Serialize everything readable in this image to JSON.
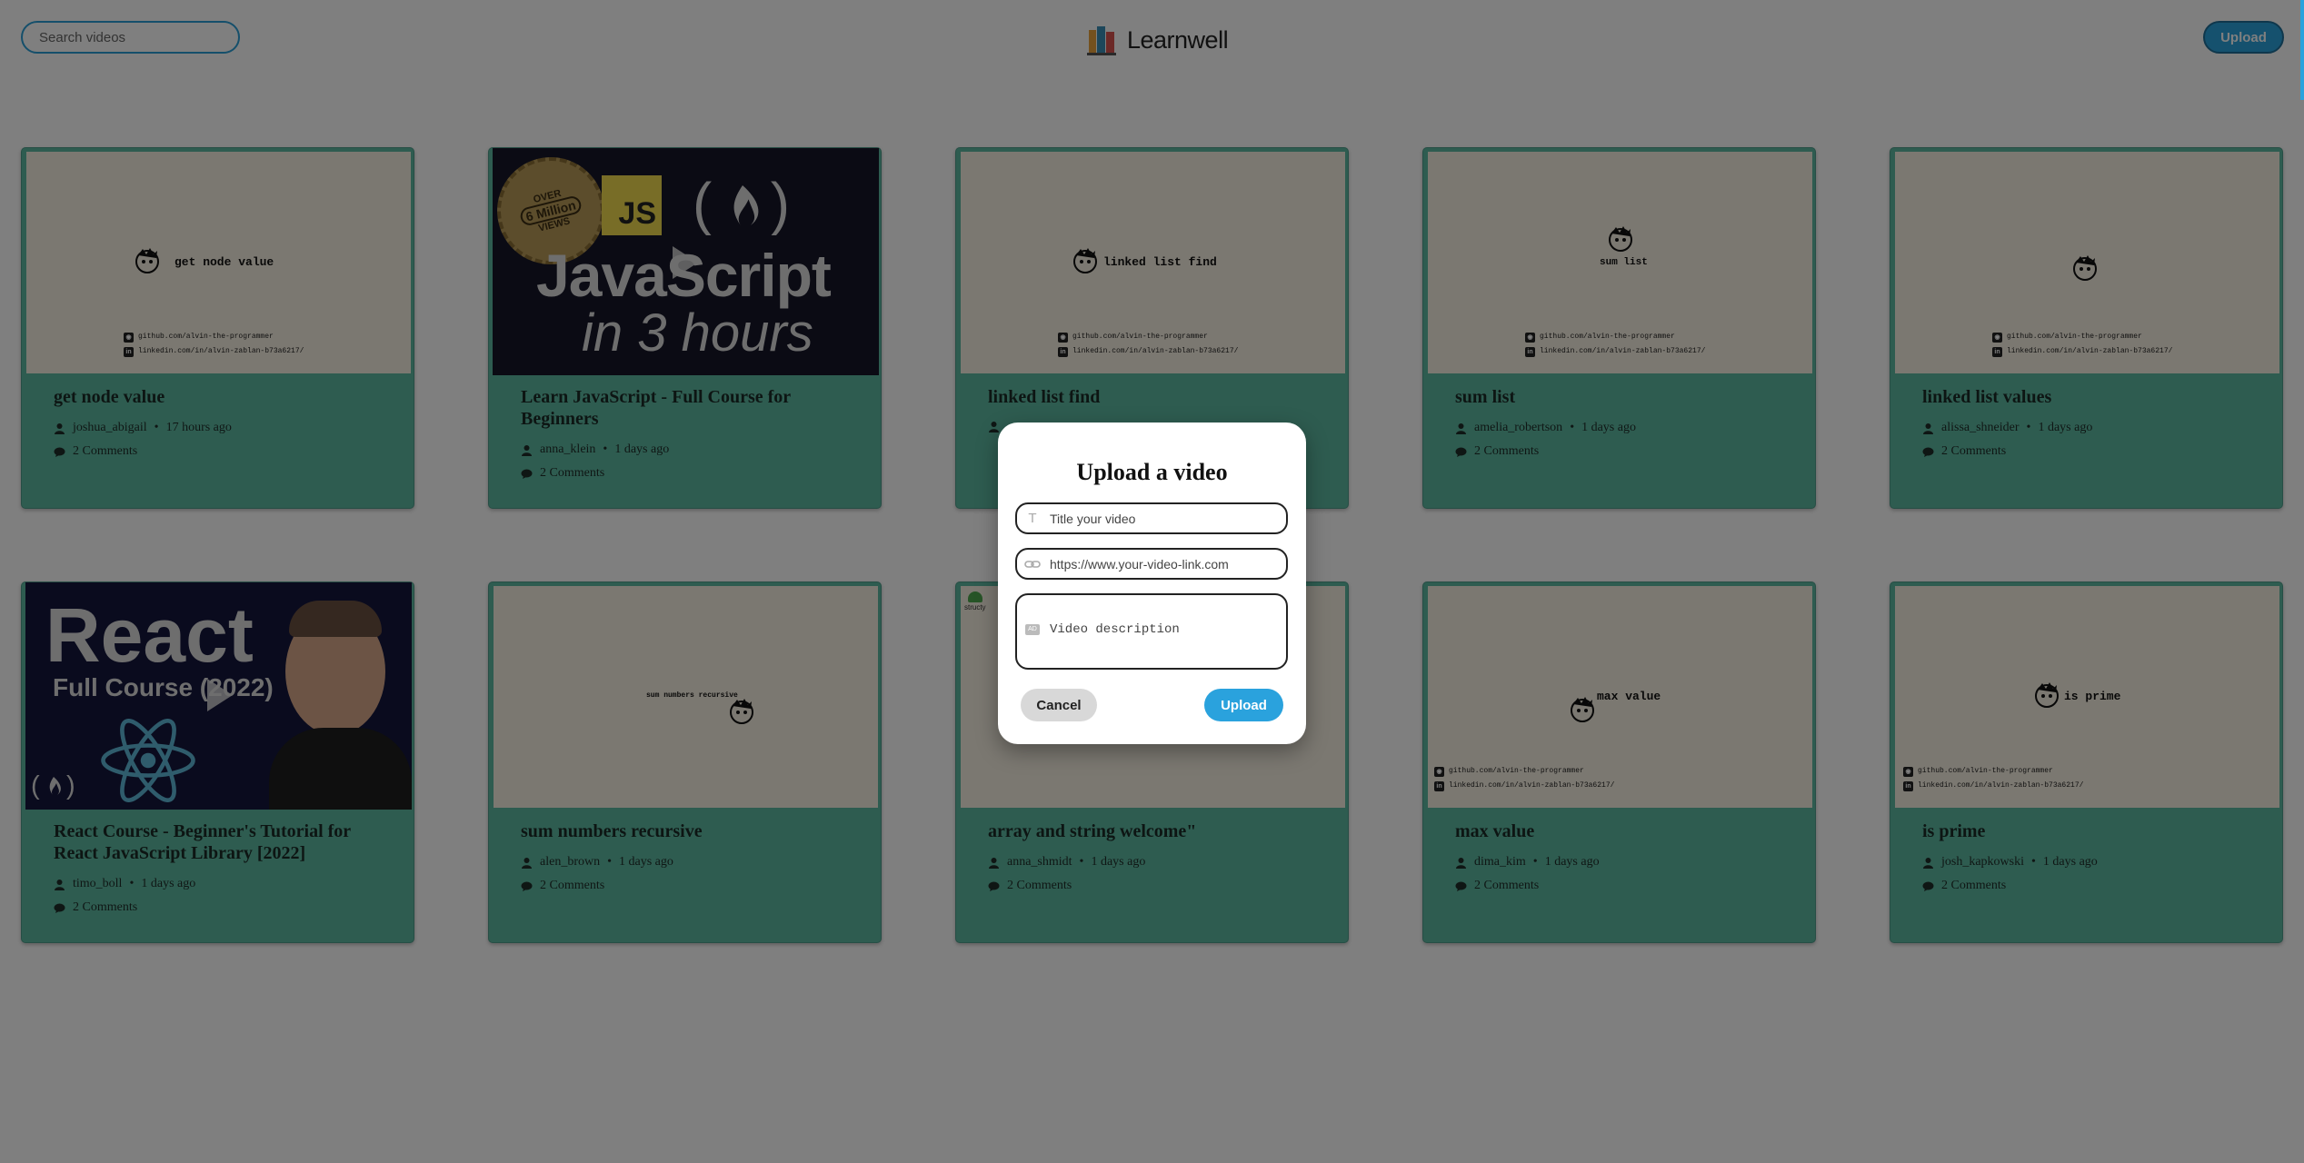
{
  "header": {
    "search_placeholder": "Search videos",
    "brand": "Learnwell",
    "upload_label": "Upload"
  },
  "videos": [
    {
      "title": "get node value",
      "thumb_text": "get node value",
      "author": "joshua_abigail",
      "time": "17 hours ago",
      "comments": "2 Comments"
    },
    {
      "title": "Learn JavaScript - Full Course for Beginners",
      "author": "anna_klein",
      "time": "1 days ago",
      "comments": "2 Comments",
      "thumb_big": "JavaScript",
      "thumb_sub": "in 3 hours",
      "badge_top": "OVER",
      "badge_mid": "6 Million",
      "badge_bot": "VIEWS",
      "js": "JS"
    },
    {
      "title": "linked list find",
      "thumb_text": "linked list find",
      "author": "",
      "time": "",
      "comments": ""
    },
    {
      "title": "sum list",
      "thumb_text": "sum list",
      "author": "amelia_robertson",
      "time": "1 days ago",
      "comments": "2 Comments"
    },
    {
      "title": "linked list values",
      "thumb_text": "",
      "author": "alissa_shneider",
      "time": "1 days ago",
      "comments": "2 Comments"
    },
    {
      "title": "React Course - Beginner's Tutorial for React JavaScript Library [2022]",
      "author": "timo_boll",
      "time": "1 days ago",
      "comments": "2 Comments",
      "thumb_big": "React",
      "thumb_sub": "Full Course",
      "thumb_year": "(2022)"
    },
    {
      "title": "sum numbers recursive",
      "thumb_text": "sum numbers recursive",
      "author": "alen_brown",
      "time": "1 days ago",
      "comments": "2 Comments"
    },
    {
      "title": "array and string welcome\"",
      "thumb_text": "",
      "author": "anna_shmidt",
      "time": "1 days ago",
      "comments": "2 Comments",
      "thumb_brand": "structy"
    },
    {
      "title": "max value",
      "thumb_text": "max value",
      "author": "dima_kim",
      "time": "1 days ago",
      "comments": "2 Comments"
    },
    {
      "title": "is prime",
      "thumb_text": "is prime",
      "author": "josh_kapkowski",
      "time": "1 days ago",
      "comments": "2 Comments"
    }
  ],
  "thumb_links": {
    "github": "github.com/alvin-the-programmer",
    "linkedin": "linkedin.com/in/alvin-zablan-b73a6217/"
  },
  "modal": {
    "title": "Upload a video",
    "title_placeholder": "Title your video",
    "url_placeholder": "https://www.your-video-link.com",
    "description_placeholder": "Video description",
    "cancel_label": "Cancel",
    "upload_label": "Upload"
  },
  "colors": {
    "accent": "#2aa2dd",
    "card": "#5cb8a1",
    "overlay": "rgba(0,0,0,0.5)"
  }
}
